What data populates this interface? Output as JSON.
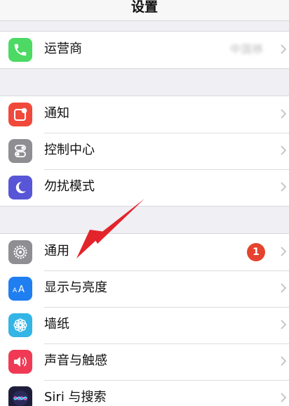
{
  "nav": {
    "title": "设置"
  },
  "groups": [
    {
      "items": [
        {
          "label": "运营商",
          "value": "中国移",
          "icon": "phone-icon",
          "color": "#4cd964"
        }
      ]
    },
    {
      "items": [
        {
          "label": "通知",
          "icon": "notifications-icon",
          "color": "#f0493c"
        },
        {
          "label": "控制中心",
          "icon": "control-center-icon",
          "color": "#8e8e93"
        },
        {
          "label": "勿扰模式",
          "icon": "moon-icon",
          "color": "#5856d6"
        }
      ]
    },
    {
      "items": [
        {
          "label": "通用",
          "icon": "gear-icon",
          "color": "#8e8e93",
          "badge": "1"
        },
        {
          "label": "显示与亮度",
          "icon": "display-aa-icon",
          "color": "#1f7ef0"
        },
        {
          "label": "墙纸",
          "icon": "wallpaper-flower-icon",
          "color": "#33b5e5"
        },
        {
          "label": "声音与触感",
          "icon": "speaker-icon",
          "color": "#f03a55"
        },
        {
          "label": "Siri 与搜索",
          "icon": "siri-icon",
          "color": "#1e1e3c"
        }
      ]
    }
  ],
  "annotation": {
    "arrow_color": "#e3242b",
    "icon": "red-arrow-pointer"
  },
  "colors": {
    "badge": "#e5432f",
    "background": "#efeff4",
    "chevron": "#c7c7cc"
  }
}
